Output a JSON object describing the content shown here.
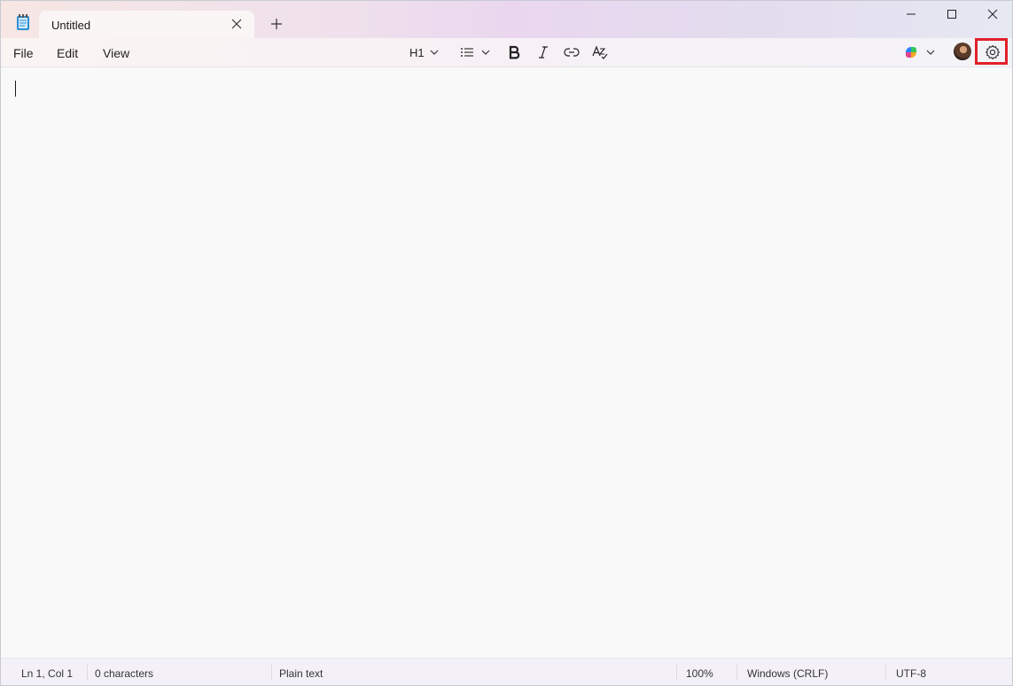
{
  "tab": {
    "title": "Untitled"
  },
  "menu": {
    "file": "File",
    "edit": "Edit",
    "view": "View"
  },
  "toolbar": {
    "heading_label": "H1"
  },
  "status": {
    "position": "Ln 1, Col 1",
    "characters": "0 characters",
    "format": "Plain text",
    "zoom": "100%",
    "line_ending": "Windows (CRLF)",
    "encoding": "UTF-8"
  },
  "icons": {
    "app": "notepad-icon",
    "close_tab": "close-icon",
    "new_tab": "plus-icon",
    "minimize": "minimize-icon",
    "maximize": "maximize-icon",
    "close": "close-icon",
    "list": "list-icon",
    "bold": "bold-icon",
    "italic": "italic-icon",
    "link": "link-icon",
    "clear_format": "clear-formatting-icon",
    "copilot": "copilot-icon",
    "settings": "gear-icon"
  },
  "colors": {
    "highlight": "#e0202a"
  }
}
